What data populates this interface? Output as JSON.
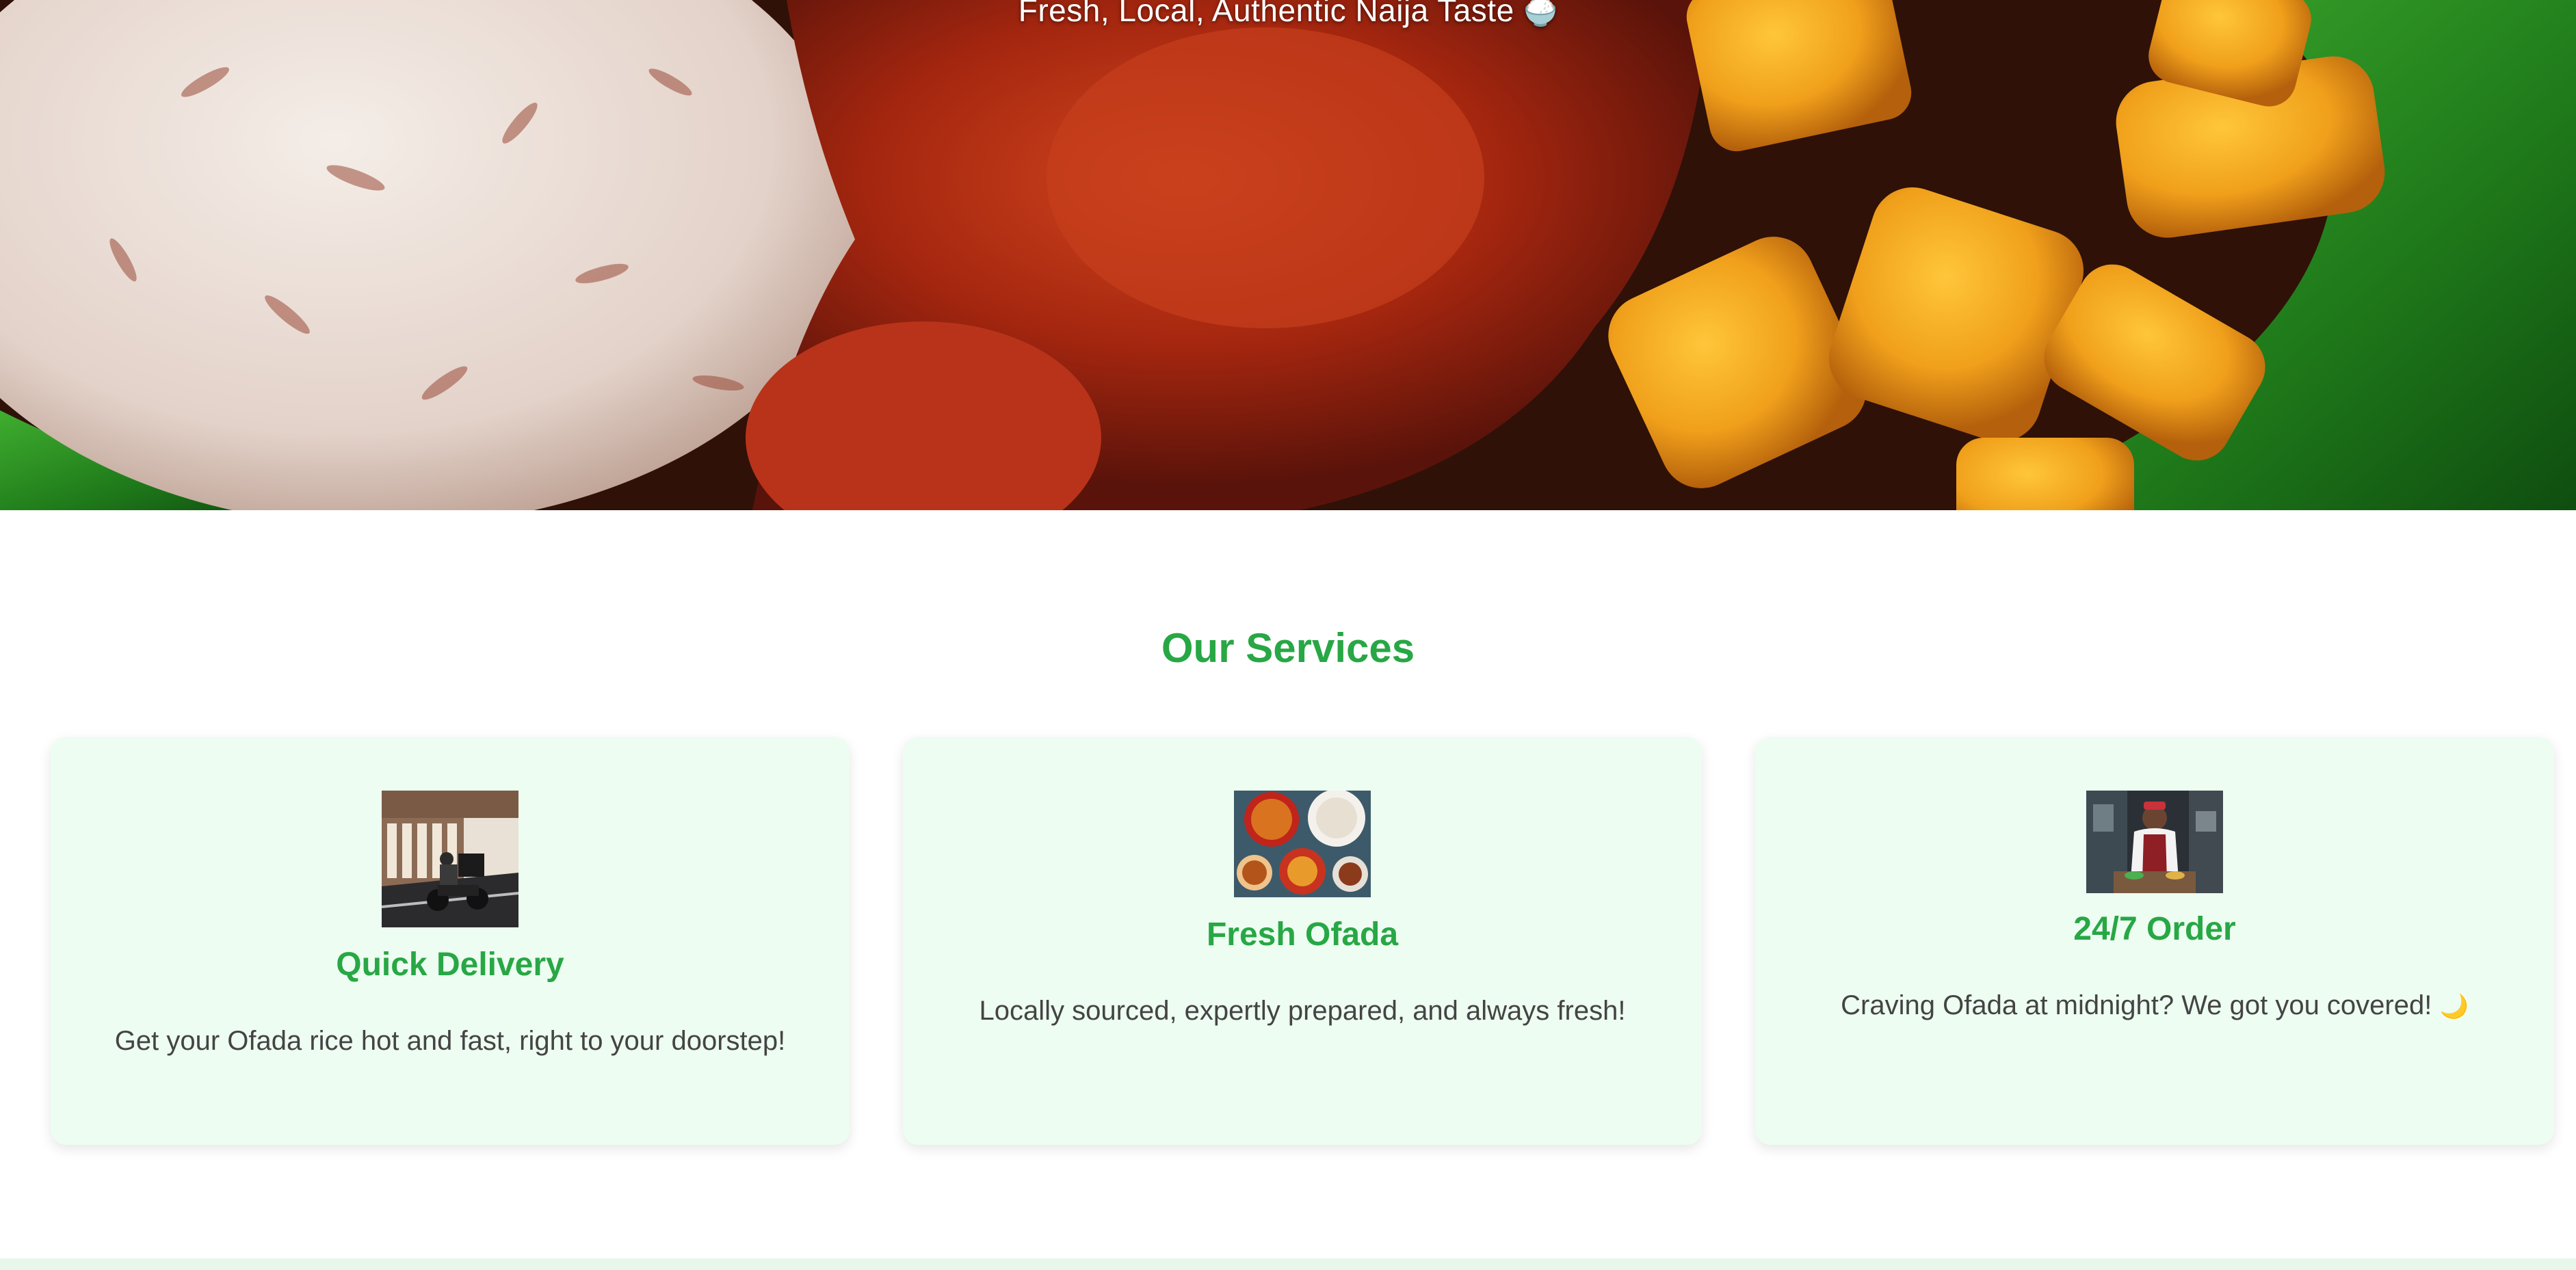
{
  "hero": {
    "tagline": "Fresh, Local, Authentic Naija Taste",
    "tagline_emoji": "🍚",
    "image_icon": "ofada-rice-plate-image"
  },
  "services": {
    "title": "Our Services",
    "cards": [
      {
        "title": "Quick Delivery",
        "text": "Get your Ofada rice hot and fast, right to your doorstep!",
        "image_icon": "delivery-rider-image"
      },
      {
        "title": "Fresh Ofada",
        "text": "Locally sourced, expertly prepared, and always fresh!",
        "image_icon": "ofada-dishes-image"
      },
      {
        "title": "24/7 Order",
        "text": "Craving Ofada at midnight? We got you covered!",
        "text_emoji": "🌙",
        "image_icon": "chef-kitchen-image"
      }
    ]
  },
  "colors": {
    "accent_green": "#28a745",
    "card_background": "#edfdf1",
    "body_text": "#444444",
    "footer_strip": "#e7f7ec"
  }
}
